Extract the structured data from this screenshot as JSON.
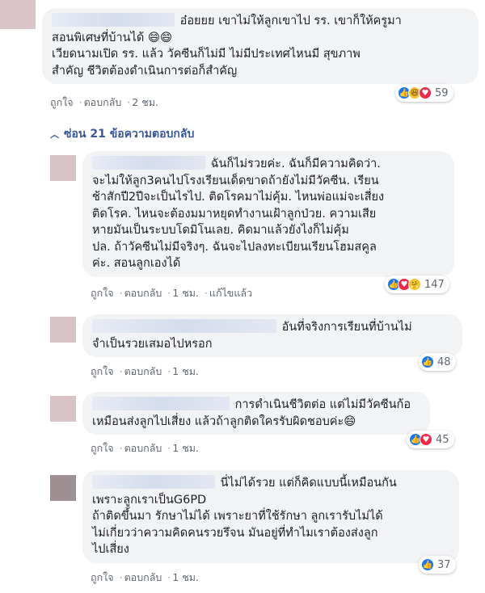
{
  "main_comment": {
    "text_line1": "อ๋อยยย เขาไม่ให้ลูกเขาไป รร. เขาก็ให้ครูมา",
    "text_rest": "สอนพิเศษที่บ้านได้ 😄😄\nเวียดนามเปิด รร. แล้ว วัคซีนก็ไม่มี ไม่มีประเทศไหนมี สุขภาพ\nสำคัญ ชีวิตต้องดำเนินการต่อก็สำคัญ",
    "like": "ถูกใจ",
    "reply": "ตอบกลับ",
    "time": "2 ชม.",
    "reaction_count": "59"
  },
  "hide_replies_label": "ซ่อน 21 ข้อความตอบกลับ",
  "replies": [
    {
      "text_line1": "ฉันก็ไม่รวยค่ะ. ฉันก็มีความคิดว่า.",
      "text_rest": "จะไม่ให้ลูก3คนไปโรงเรียนเด็ดขาดถ้ายังไม่มีวัคซีน. เรียน\nช้าสักปี2ปีจะเป็นไรไป. ติดโรคมาไม่คุ้ม. ไหนพ่อแม่จะเสี่ยง\nติดโรค. ไหนจะต้องมมาหยุดทำงานเฝ้าลูกป่วย. ความเสีย\nหายมันเป็นระบบโดมิโนเลย. คิดมาแล้วยังไงก็ไม่คุ้ม\nปล. ถ้าวัคซีนไม่มีจริงๆ. ฉันจะไปลงทะเบียนเรียนโฮมสคูล\nค่ะ. สอนลูกเองได้",
      "like": "ถูกใจ",
      "reply": "ตอบกลับ",
      "time": "1 ชม.",
      "edited": "แก้ไขแล้ว",
      "reaction_count": "147"
    },
    {
      "text_line1": "อันที่จริงการเรียนที่บ้านไม่",
      "text_rest": "จำเป็นรวยเสมอไปหรอก",
      "like": "ถูกใจ",
      "reply": "ตอบกลับ",
      "time": "1 ชม.",
      "reaction_count": "48"
    },
    {
      "text_line1": "การดำเนินชีวิตต่อ แต่ไม่มีวัคซีนก้อ",
      "text_rest": "เหมือนส่งลูกไปเสี่ยง แล้วถ้าลูกติดใครรับผิดชอบค่ะ😄",
      "like": "ถูกใจ",
      "reply": "ตอบกลับ",
      "time": "1 ชม.",
      "reaction_count": "45"
    },
    {
      "text_line1": "นี่ไม่ได้รวย แต่ก็คิดแบบนี้เหมือนกัน",
      "text_rest": "เพราะลูกเราเป็นG6PD\nถ้าติดขึ้นมา รักษาไม่ได้ เพราะยาที่ใช้รักษา ลูกเรารับไม่ได้\nไม่เกี่ยวว่าความคิดคนรวยรึจน มันอยู่ที่ทำไมเราต้องส่งลูก\nไปเสี่ยง",
      "like": "ถูกใจ",
      "reply": "ตอบกลับ",
      "time": "1 ชม.",
      "reaction_count": "37"
    }
  ],
  "colors": {
    "link": "#385898",
    "bubble": "#f2f3f5",
    "meta": "#606770",
    "like_blue": "#1877f2"
  }
}
